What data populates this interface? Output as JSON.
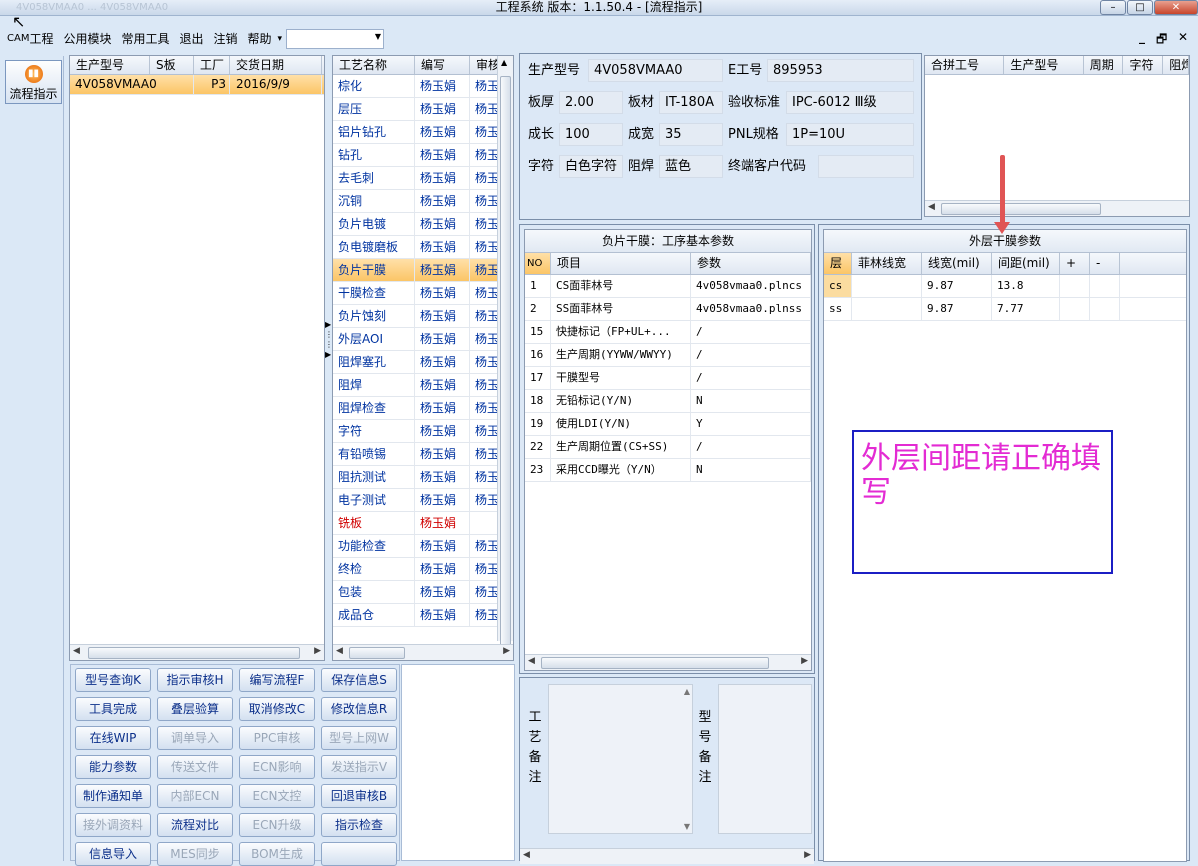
{
  "window": {
    "title": "工程系统  版本：1.1.50.4 - [流程指示]",
    "stub": "4V058VMAA0 ... 4V058VMAA0"
  },
  "menu": {
    "cam": "CAM",
    "items": [
      "工程",
      "公用模块",
      "常用工具",
      "退出",
      "注销",
      "帮助"
    ],
    "dropdown_caret": "▾",
    "combo_value": ""
  },
  "mdi": {
    "minimize": "_",
    "restore": "🗗",
    "close": "✕"
  },
  "left": {
    "flow_label": "流程指示"
  },
  "orders": {
    "headers": [
      "生产型号",
      "S板",
      "工厂",
      "交货日期"
    ],
    "rows": [
      {
        "model": "4V058VMAA0",
        "s": "",
        "factory": "P3",
        "date": "2016/9/9"
      }
    ]
  },
  "steps": {
    "headers": [
      "工艺名称",
      "编写",
      "审核"
    ],
    "rows": [
      {
        "name": "棕化",
        "writer": "杨玉娟",
        "rev": "杨玉"
      },
      {
        "name": "层压",
        "writer": "杨玉娟",
        "rev": "杨玉"
      },
      {
        "name": "铝片钻孔",
        "writer": "杨玉娟",
        "rev": "杨玉"
      },
      {
        "name": "钻孔",
        "writer": "杨玉娟",
        "rev": "杨玉"
      },
      {
        "name": "去毛刺",
        "writer": "杨玉娟",
        "rev": "杨玉"
      },
      {
        "name": "沉铜",
        "writer": "杨玉娟",
        "rev": "杨玉"
      },
      {
        "name": "负片电镀",
        "writer": "杨玉娟",
        "rev": "杨玉"
      },
      {
        "name": "负电镀磨板",
        "writer": "杨玉娟",
        "rev": "杨玉"
      },
      {
        "name": "负片干膜",
        "writer": "杨玉娟",
        "rev": "杨玉"
      },
      {
        "name": "干膜检查",
        "writer": "杨玉娟",
        "rev": "杨玉"
      },
      {
        "name": "负片蚀刻",
        "writer": "杨玉娟",
        "rev": "杨玉"
      },
      {
        "name": "外层AOI",
        "writer": "杨玉娟",
        "rev": "杨玉"
      },
      {
        "name": "阻焊塞孔",
        "writer": "杨玉娟",
        "rev": "杨玉"
      },
      {
        "name": "阻焊",
        "writer": "杨玉娟",
        "rev": "杨玉"
      },
      {
        "name": "阻焊检查",
        "writer": "杨玉娟",
        "rev": "杨玉"
      },
      {
        "name": "字符",
        "writer": "杨玉娟",
        "rev": "杨玉"
      },
      {
        "name": "有铅喷锡",
        "writer": "杨玉娟",
        "rev": "杨玉"
      },
      {
        "name": "阻抗测试",
        "writer": "杨玉娟",
        "rev": "杨玉"
      },
      {
        "name": "电子测试",
        "writer": "杨玉娟",
        "rev": "杨玉"
      },
      {
        "name": "铣板",
        "writer": "杨玉娟",
        "rev": ""
      },
      {
        "name": "功能检查",
        "writer": "杨玉娟",
        "rev": "杨玉"
      },
      {
        "name": "终检",
        "writer": "杨玉娟",
        "rev": "杨玉"
      },
      {
        "name": "包装",
        "writer": "杨玉娟",
        "rev": "杨玉"
      },
      {
        "name": "成品仓",
        "writer": "杨玉娟",
        "rev": "杨玉"
      }
    ],
    "selected_index": 8,
    "red_index": 19
  },
  "buttons": [
    {
      "label": "型号查询K",
      "enabled": true
    },
    {
      "label": "指示审核H",
      "enabled": true
    },
    {
      "label": "编写流程F",
      "enabled": true
    },
    {
      "label": "保存信息S",
      "enabled": true
    },
    {
      "label": "工具完成",
      "enabled": true
    },
    {
      "label": "叠层验算",
      "enabled": true
    },
    {
      "label": "取消修改C",
      "enabled": true
    },
    {
      "label": "修改信息R",
      "enabled": true
    },
    {
      "label": "在线WIP",
      "enabled": true
    },
    {
      "label": "调单导入",
      "enabled": false
    },
    {
      "label": "PPC审核",
      "enabled": false
    },
    {
      "label": "型号上网W",
      "enabled": false
    },
    {
      "label": "能力参数",
      "enabled": true
    },
    {
      "label": "传送文件",
      "enabled": false
    },
    {
      "label": "ECN影响",
      "enabled": false
    },
    {
      "label": "发送指示V",
      "enabled": false
    },
    {
      "label": "制作通知单",
      "enabled": true
    },
    {
      "label": "内部ECN",
      "enabled": false
    },
    {
      "label": "ECN文控",
      "enabled": false
    },
    {
      "label": "回退审核B",
      "enabled": true
    },
    {
      "label": "接外调资料",
      "enabled": false
    },
    {
      "label": "流程对比",
      "enabled": true
    },
    {
      "label": "ECN升级",
      "enabled": false
    },
    {
      "label": "指示检查",
      "enabled": true
    },
    {
      "label": "信息导入",
      "enabled": true
    },
    {
      "label": "MES同步",
      "enabled": false
    },
    {
      "label": "BOM生成",
      "enabled": false
    },
    {
      "label": "",
      "enabled": true
    }
  ],
  "info": {
    "model_label": "生产型号",
    "model": "4V058VMAA0",
    "e_label": "E工号",
    "e": "895953",
    "thick_label": "板厚",
    "thick": "2.00",
    "mat_label": "板材",
    "mat": "IT-180A",
    "std_label": "验收标准",
    "std": "IPC-6012 Ⅲ级",
    "len_label": "成长",
    "len": "100",
    "wid_label": "成宽",
    "wid": "35",
    "pnl_label": "PNL规格",
    "pnl": "1P=10U",
    "char_label": "字符",
    "char": "白色字符",
    "mask_label": "阻焊",
    "mask": "蓝色",
    "cust_label": "终端客户代码",
    "cust": ""
  },
  "combine": {
    "headers": [
      "合拼工号",
      "生产型号",
      "周期",
      "字符",
      "阻焊"
    ]
  },
  "params": {
    "title": "负片干膜：工序基本参数",
    "headers": [
      "NO",
      "项目",
      "参数"
    ],
    "rows": [
      {
        "no": "1",
        "item": "CS面菲林号",
        "val": "4v058vmaa0.plncs"
      },
      {
        "no": "2",
        "item": "SS面菲林号",
        "val": "4v058vmaa0.plnss"
      },
      {
        "no": "15",
        "item": "快捷标记（FP+UL+...",
        "val": "/"
      },
      {
        "no": "16",
        "item": "生产周期(YYWW/WWYY)",
        "val": "/"
      },
      {
        "no": "17",
        "item": "干膜型号",
        "val": "/"
      },
      {
        "no": "18",
        "item": "无铅标记(Y/N)",
        "val": "N"
      },
      {
        "no": "19",
        "item": "使用LDI(Y/N)",
        "val": "Y"
      },
      {
        "no": "22",
        "item": "生产周期位置(CS+SS)",
        "val": "/"
      },
      {
        "no": "23",
        "item": "采用CCD曝光（Y/N）",
        "val": "N"
      }
    ]
  },
  "outer": {
    "title": "外层干膜参数",
    "headers": [
      "层",
      "菲林线宽",
      "线宽(mil)",
      "间距(mil)",
      "+",
      "-"
    ],
    "rows": [
      {
        "layer": "cs",
        "film": "",
        "lw": "9.87",
        "sp": "13.8"
      },
      {
        "layer": "ss",
        "film": "",
        "lw": "9.87",
        "sp": "7.77"
      }
    ]
  },
  "notes": {
    "craft_label": "工艺备注",
    "model_label": "型号备注"
  },
  "annotation": {
    "text": "外层间距请正确填写"
  },
  "colors": {
    "accent": "#0033a0",
    "note_text": "#e32bd3",
    "note_border": "#1b1ec4",
    "selected": "#fbc566"
  }
}
